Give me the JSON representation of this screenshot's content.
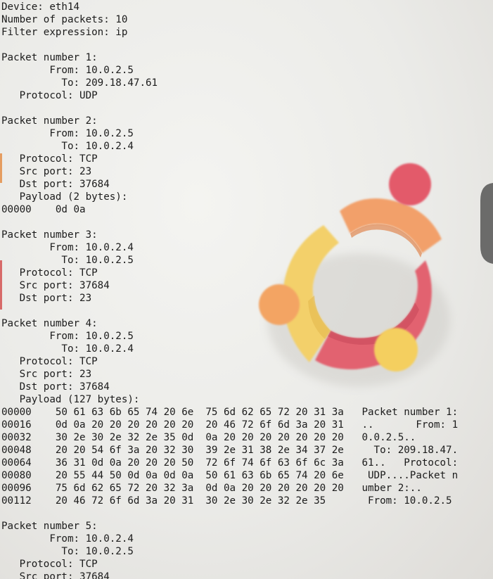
{
  "header": {
    "device": "Device: eth14",
    "num_packets": "Number of packets: 10",
    "filter": "Filter expression: ip"
  },
  "packets": [
    {
      "title": "Packet number 1:",
      "from": "From: 10.0.2.5",
      "to": "To: 209.18.47.61",
      "protocol": "Protocol: UDP"
    },
    {
      "title": "Packet number 2:",
      "from": "From: 10.0.2.5",
      "to": "To: 10.0.2.4",
      "protocol": "Protocol: TCP",
      "src_port": "Src port: 23",
      "dst_port": "Dst port: 37684",
      "payload": "Payload (2 bytes):",
      "hex": [
        {
          "offset": "00000",
          "b1": "0d 0a",
          "b2": "",
          "ascii": ""
        }
      ]
    },
    {
      "title": "Packet number 3:",
      "from": "From: 10.0.2.4",
      "to": "To: 10.0.2.5",
      "protocol": "Protocol: TCP",
      "src_port": "Src port: 37684",
      "dst_port": "Dst port: 23"
    },
    {
      "title": "Packet number 4:",
      "from": "From: 10.0.2.5",
      "to": "To: 10.0.2.4",
      "protocol": "Protocol: TCP",
      "src_port": "Src port: 23",
      "dst_port": "Dst port: 37684",
      "payload": "Payload (127 bytes):",
      "hex": [
        {
          "offset": "00000",
          "b1": "50 61 63 6b 65 74 20 6e",
          "b2": "75 6d 62 65 72 20 31 3a",
          "ascii": "Packet number 1:"
        },
        {
          "offset": "00016",
          "b1": "0d 0a 20 20 20 20 20 20",
          "b2": "20 46 72 6f 6d 3a 20 31",
          "ascii": "..       From: 1"
        },
        {
          "offset": "00032",
          "b1": "30 2e 30 2e 32 2e 35 0d",
          "b2": "0a 20 20 20 20 20 20 20",
          "ascii": "0.0.2.5.."
        },
        {
          "offset": "00048",
          "b1": "20 20 54 6f 3a 20 32 30",
          "b2": "39 2e 31 38 2e 34 37 2e",
          "ascii": "  To: 209.18.47."
        },
        {
          "offset": "00064",
          "b1": "36 31 0d 0a 20 20 20 50",
          "b2": "72 6f 74 6f 63 6f 6c 3a",
          "ascii": "61..   Protocol:"
        },
        {
          "offset": "00080",
          "b1": "20 55 44 50 0d 0a 0d 0a",
          "b2": "50 61 63 6b 65 74 20 6e",
          "ascii": " UDP....Packet n"
        },
        {
          "offset": "00096",
          "b1": "75 6d 62 65 72 20 32 3a",
          "b2": "0d 0a 20 20 20 20 20 20",
          "ascii": "umber 2:.."
        },
        {
          "offset": "00112",
          "b1": "20 46 72 6f 6d 3a 20 31",
          "b2": "30 2e 30 2e 32 2e 35",
          "ascii": " From: 10.0.2.5"
        }
      ]
    },
    {
      "title": "Packet number 5:",
      "from": "From: 10.0.2.4",
      "to": "To: 10.0.2.5",
      "protocol": "Protocol: TCP",
      "src_port": "Src port: 37684"
    }
  ],
  "colors": {
    "text": "#1b1b1b",
    "logo_red": "#e05a68",
    "logo_orange": "#f39f5f",
    "logo_yellow": "#f6cf5f"
  }
}
